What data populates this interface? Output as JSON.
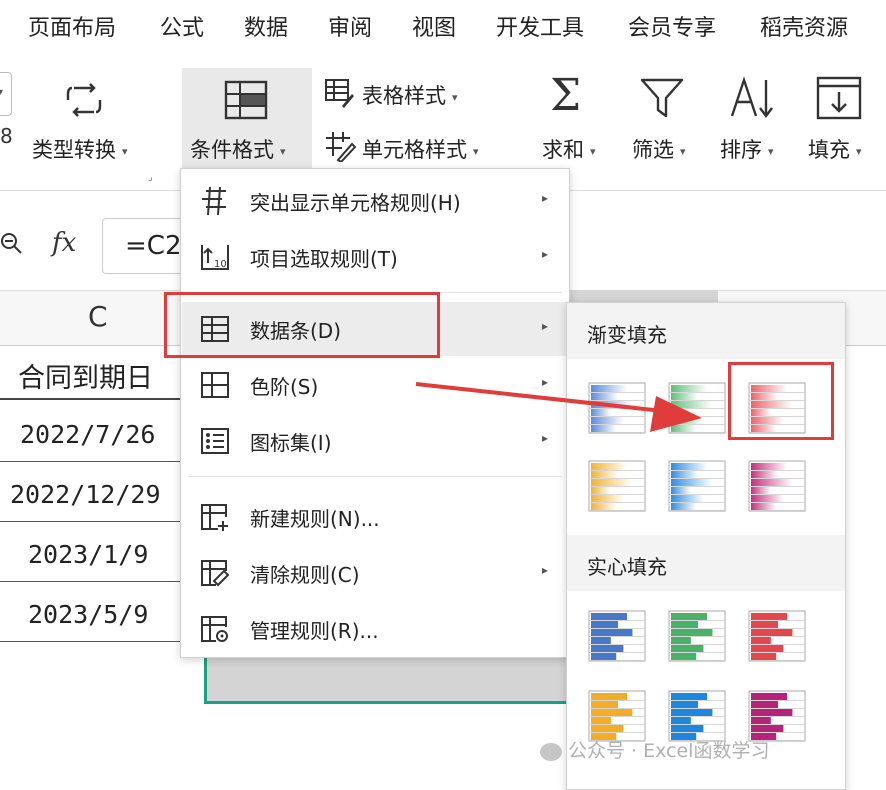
{
  "tabs": [
    "页面布局",
    "公式",
    "数据",
    "审阅",
    "视图",
    "开发工具",
    "会员专享",
    "稻壳资源"
  ],
  "ribbon": {
    "type_convert": "类型转换",
    "cond_format": "条件格式",
    "table_style": "表格样式",
    "cell_style": "单元格样式",
    "sum": "求和",
    "filter": "筛选",
    "sort": "排序",
    "fill": "填充"
  },
  "formula_bar": {
    "fx": "fx",
    "value": "=C2"
  },
  "sheet": {
    "col_header": "C",
    "header_cell": "合同到期日",
    "dates": [
      "2022/7/26",
      "2022/12/29",
      "2023/1/9",
      "2023/5/9"
    ]
  },
  "menu": {
    "items": [
      {
        "label": "突出显示单元格规则(H)",
        "icon": "highlight-rules-icon",
        "submenu": true
      },
      {
        "label": "项目选取规则(T)",
        "icon": "top-bottom-rules-icon",
        "submenu": true
      },
      {
        "label": "数据条(D)",
        "icon": "data-bars-icon",
        "submenu": true
      },
      {
        "label": "色阶(S)",
        "icon": "color-scales-icon",
        "submenu": true
      },
      {
        "label": "图标集(I)",
        "icon": "icon-sets-icon",
        "submenu": true
      },
      {
        "label": "新建规则(N)...",
        "icon": "new-rule-icon",
        "submenu": false
      },
      {
        "label": "清除规则(C)",
        "icon": "clear-rules-icon",
        "submenu": true
      },
      {
        "label": "管理规则(R)...",
        "icon": "manage-rules-icon",
        "submenu": false
      }
    ]
  },
  "submenu": {
    "gradient_title": "渐变填充",
    "solid_title": "实心填充",
    "gradient_colors": [
      "#5b8bd6",
      "#5fbf7a",
      "#e8646b",
      "#f2b233",
      "#2e8ee0",
      "#c4307e"
    ],
    "solid_colors": [
      "#4a78c8",
      "#4bb06a",
      "#e0474f",
      "#f2ac25",
      "#1f86e0",
      "#b8237a"
    ]
  },
  "highlight_color": "#e03c3c",
  "watermark": "公众号 · Excel函数学习"
}
